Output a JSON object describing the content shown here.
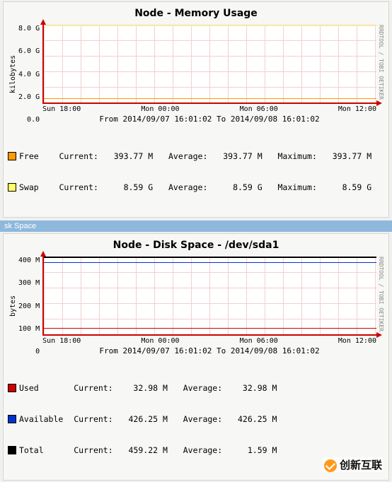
{
  "chart_data": [
    {
      "type": "line",
      "title": "Node - Memory Usage",
      "ylabel": "kilobytes",
      "xlabel": "",
      "ylim": [
        0,
        8.5
      ],
      "y_unit": "G",
      "x_categories": [
        "Sun 18:00",
        "Mon 00:00",
        "Mon 06:00",
        "Mon 12:00"
      ],
      "series": [
        {
          "name": "Free",
          "color": "#ff9a00",
          "value_g": 0.394
        },
        {
          "name": "Swap",
          "color": "#ffff66",
          "value_g": 8.59
        }
      ],
      "range_text": "From 2014/09/07 16:01:02 To 2014/09/08 16:01:02",
      "watermark": "RRDTOOL / TOBI OETIKER"
    },
    {
      "type": "line",
      "title": "Node - Disk Space - /dev/sda1",
      "ylabel": "bytes",
      "xlabel": "",
      "ylim": [
        0,
        460
      ],
      "y_unit": "M",
      "x_categories": [
        "Sun 18:00",
        "Mon 00:00",
        "Mon 06:00",
        "Mon 12:00"
      ],
      "series": [
        {
          "name": "Used",
          "color": "#cc0000",
          "value_m": 32.98
        },
        {
          "name": "Available",
          "color": "#0033cc",
          "value_m": 426.25
        },
        {
          "name": "Total",
          "color": "#000000",
          "value_m": 459.22
        }
      ],
      "range_text": "From 2014/09/07 16:01:02 To 2014/09/08 16:01:02",
      "watermark": "RRDTOOL / TOBI OETIKER"
    }
  ],
  "memory": {
    "title": "Node - Memory Usage",
    "ylabel": "kilobytes",
    "yticks": [
      "8.0 G",
      "6.0 G",
      "4.0 G",
      "2.0 G",
      "0.0  "
    ],
    "xticks": [
      "Sun 18:00",
      "Mon 00:00",
      "Mon 06:00",
      "Mon 12:00"
    ],
    "range": "From 2014/09/07 16:01:02 To 2014/09/08 16:01:02",
    "rside": "RRDTOOL / TOBI OETIKER",
    "legend": {
      "free": {
        "label": "Free",
        "color": "#ff9a00",
        "cur_lbl": "Current:",
        "cur": "393.77 M",
        "avg_lbl": "Average:",
        "avg": "393.77 M",
        "max_lbl": "Maximum:",
        "max": "393.77 M"
      },
      "swap": {
        "label": "Swap",
        "color": "#ffff66",
        "cur_lbl": "Current:",
        "cur": "8.59 G",
        "avg_lbl": "Average:",
        "avg": "8.59 G",
        "max_lbl": "Maximum:",
        "max": "8.59 G"
      }
    }
  },
  "section_bar": "sk Space",
  "disk": {
    "title": "Node - Disk Space - /dev/sda1",
    "ylabel": "bytes",
    "yticks": [
      "400 M",
      "300 M",
      "200 M",
      "100 M",
      "0    "
    ],
    "xticks": [
      "Sun 18:00",
      "Mon 00:00",
      "Mon 06:00",
      "Mon 12:00"
    ],
    "range": "From 2014/09/07 16:01:02 To 2014/09/08 16:01:02",
    "rside": "RRDTOOL / TOBI OETIKER",
    "legend": {
      "used": {
        "label": "Used",
        "color": "#cc0000",
        "cur_lbl": "Current:",
        "cur": "32.98 M",
        "avg_lbl": "Average:",
        "avg": "32.98 M"
      },
      "available": {
        "label": "Available",
        "color": "#0033cc",
        "cur_lbl": "Current:",
        "cur": "426.25 M",
        "avg_lbl": "Average:",
        "avg": "426.25 M"
      },
      "total": {
        "label": "Total",
        "color": "#000000",
        "cur_lbl": "Current:",
        "cur": "459.22 M",
        "avg_lbl": "Average:",
        "avg": "1.59 M"
      }
    }
  },
  "watermark_text": "创新互联"
}
